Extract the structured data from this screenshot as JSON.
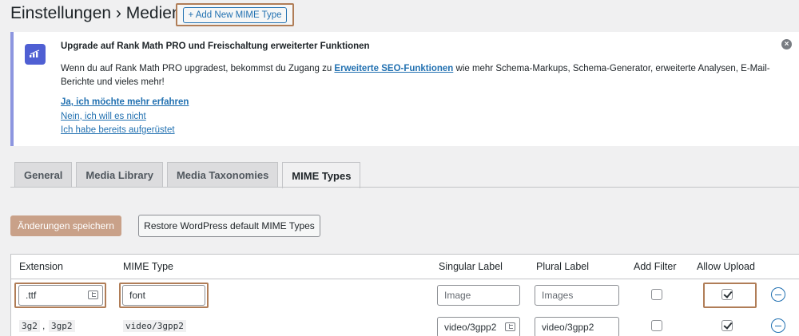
{
  "header": {
    "title": "Einstellungen › Medien",
    "add_button": "+ Add New MIME Type"
  },
  "notice": {
    "logo_icon": "rank-math-logo-icon",
    "title": "Upgrade auf Rank Math PRO und Freischaltung erweiterter Funktionen",
    "text_before": "Wenn du auf Rank Math PRO upgradest, bekommst du Zugang zu ",
    "text_link": "Erweiterte SEO-Funktionen",
    "text_after": " wie mehr Schema-Markups, Schema-Generator, erweiterte Analysen, E-Mail-Berichte und vieles mehr!",
    "links": [
      "Ja, ich möchte mehr erfahren",
      "Nein, ich will es nicht",
      "Ich habe bereits aufgerüstet"
    ],
    "dismiss_icon": "dismiss-icon"
  },
  "tabs": [
    "General",
    "Media Library",
    "Media Taxonomies",
    "MIME Types"
  ],
  "active_tab": "MIME Types",
  "buttons": {
    "save": "Änderungen speichern",
    "restore": "Restore WordPress default MIME Types"
  },
  "table": {
    "columns": [
      "Extension",
      "MIME Type",
      "Singular Label",
      "Plural Label",
      "Add Filter",
      "Allow Upload"
    ],
    "rows": [
      {
        "extension": ".ttf",
        "mime_type": "font",
        "singular_placeholder": "Image",
        "plural_placeholder": "Images",
        "add_filter": false,
        "allow_upload": true
      },
      {
        "extensions": [
          "3g2",
          "3gp2"
        ],
        "separator": ",",
        "mime_type": "video/3gpp2",
        "singular_label": "video/3gpp2",
        "plural_label": "video/3gpp2",
        "add_filter": false,
        "allow_upload": true
      }
    ]
  },
  "colors": {
    "highlight": "#b07d57",
    "link": "#2271b1",
    "save_button": "#c9a189",
    "notice_border": "#8d96e0",
    "logo_bg": "#4f5fd3"
  }
}
